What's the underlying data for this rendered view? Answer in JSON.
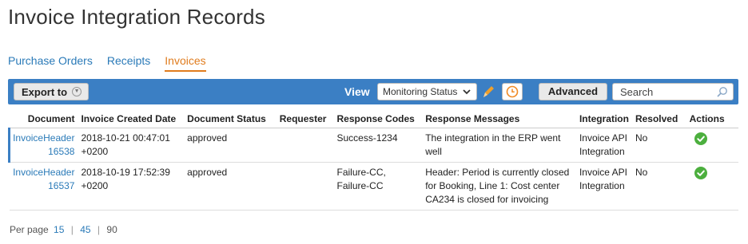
{
  "page": {
    "title": "Invoice Integration Records"
  },
  "tabs": [
    {
      "label": "Purchase Orders",
      "active": false
    },
    {
      "label": "Receipts",
      "active": false
    },
    {
      "label": "Invoices",
      "active": true
    }
  ],
  "toolbar": {
    "export_label": "Export to",
    "view_label": "View",
    "view_selected": "Monitoring Status",
    "advanced_label": "Advanced",
    "search_placeholder": "Search"
  },
  "table": {
    "headers": [
      "Document",
      "Invoice Created Date",
      "Document Status",
      "Requester",
      "Response Codes",
      "Response Messages",
      "Integration",
      "Resolved",
      "Actions"
    ],
    "rows": [
      {
        "document": [
          "InvoiceHeader",
          "16538"
        ],
        "created": [
          "2018-10-21 00:47:01",
          "+0200"
        ],
        "status": "approved",
        "requester": "",
        "codes": [
          "Success-1234"
        ],
        "messages": [
          "The integration in the ERP went",
          "well"
        ],
        "integration": [
          "Invoice API",
          "Integration"
        ],
        "resolved": "No",
        "action_icon": "check-circle-icon"
      },
      {
        "document": [
          "InvoiceHeader",
          "16537"
        ],
        "created": [
          "2018-10-19 17:52:39",
          "+0200"
        ],
        "status": "approved",
        "requester": "",
        "codes": [
          "Failure-CC,",
          "Failure-CC"
        ],
        "messages": [
          "Header: Period is currently closed",
          "for Booking, Line 1: Cost center",
          "CA234 is closed for invoicing"
        ],
        "integration": [
          "Invoice API",
          "Integration"
        ],
        "resolved": "No",
        "action_icon": "check-circle-icon"
      }
    ]
  },
  "pager": {
    "label": "Per page",
    "options": [
      "15",
      "45",
      "90"
    ],
    "separator": "|"
  },
  "colors": {
    "accent": "#3b7fc4",
    "link": "#2a7ab8",
    "active_tab": "#e07c1e",
    "success": "#4caf3e"
  }
}
